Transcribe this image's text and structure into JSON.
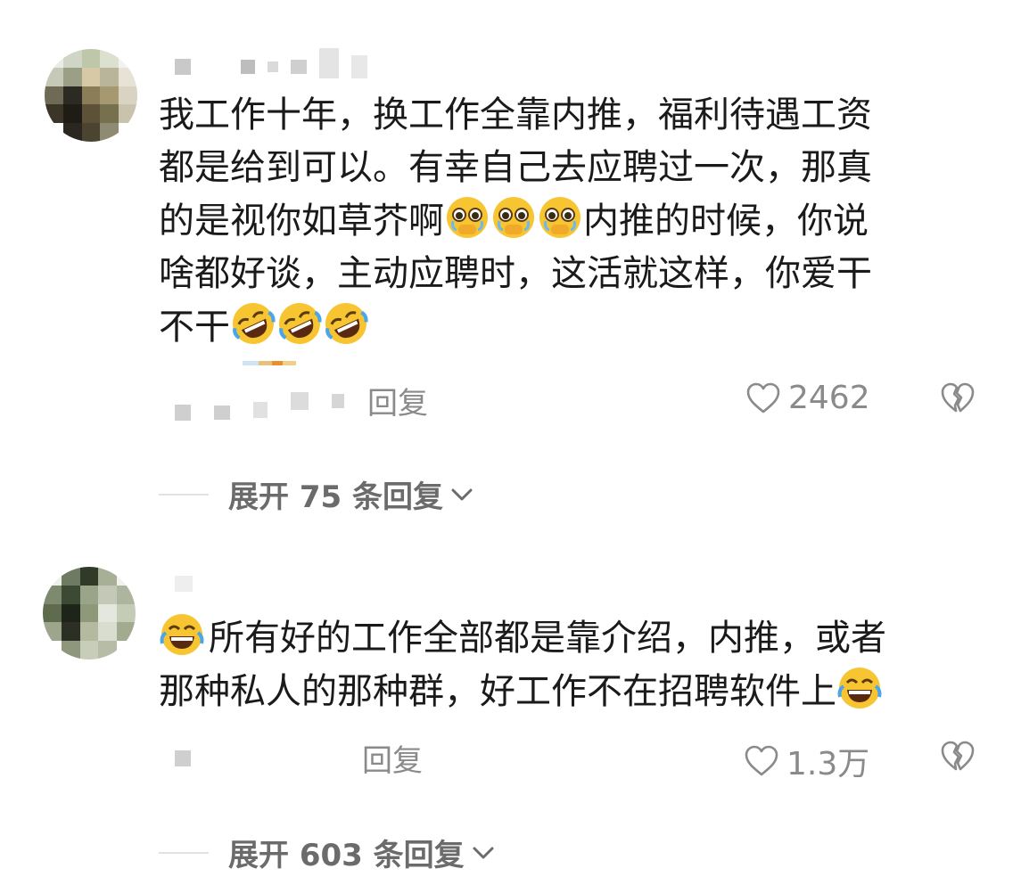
{
  "comments": [
    {
      "text_line1": "我工作十年，换工作全靠内推，福利待遇工资",
      "text_line2": "都是给到可以。有幸自己去应聘过一次，那真",
      "text_line3_a": "的是视你如草芥啊",
      "text_line3_b": "内推的时候，你说",
      "text_line4": "啥都好谈，主动应聘时，这活就这样，你爱干",
      "text_line5": "不干",
      "reply_label": "回复",
      "like_count": "2462",
      "expand_label": "展开 75 条回复"
    },
    {
      "text_line1": "所有好的工作全部都是靠介绍，内推，或者",
      "text_line2": "那种私人的那种群，好工作不在招聘软件上",
      "reply_label": "回复",
      "like_count": "1.3万",
      "expand_label": "展开 603 条回复"
    }
  ],
  "icons": {
    "like": "heart-outline-icon",
    "dislike": "broken-heart-icon",
    "expand": "chevron-down-icon",
    "emoji_pleading": "pleading-face-emoji",
    "emoji_rolling": "rolling-laughing-emoji",
    "emoji_crying_laugh": "tears-of-joy-emoji"
  },
  "colors": {
    "secondary_text": "#8a8a8a",
    "body_text": "#1a1a1a",
    "emoji_yellow": "#f7c531"
  }
}
